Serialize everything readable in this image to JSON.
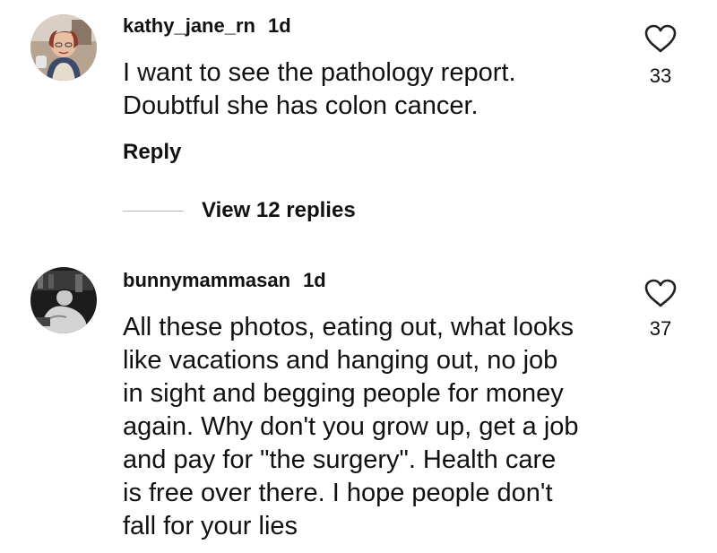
{
  "comments": [
    {
      "username": "kathy_jane_rn",
      "time": "1d",
      "text": "I want to see the pathology report.\nDoubtful she has colon cancer.",
      "likes": "33",
      "reply_label": "Reply",
      "view_replies_label": "View 12 replies",
      "avatar_icon": "avatar-photo"
    },
    {
      "username": "bunnymammasan",
      "time": "1d",
      "text": "All these photos, eating out, what looks\nlike vacations and hanging out, no job\nin sight and begging people for money\nagain. Why don't you grow up, get a job\nand pay for \"the surgery\". Health care\nis free over there. I hope people don't\nfall for your lies",
      "likes": "37",
      "avatar_icon": "avatar-photo"
    }
  ],
  "colors": {
    "text": "#111111",
    "divider": "#b8b8b8",
    "icon_stroke": "#222222"
  },
  "icons": {
    "like": "heart-outline-icon"
  }
}
